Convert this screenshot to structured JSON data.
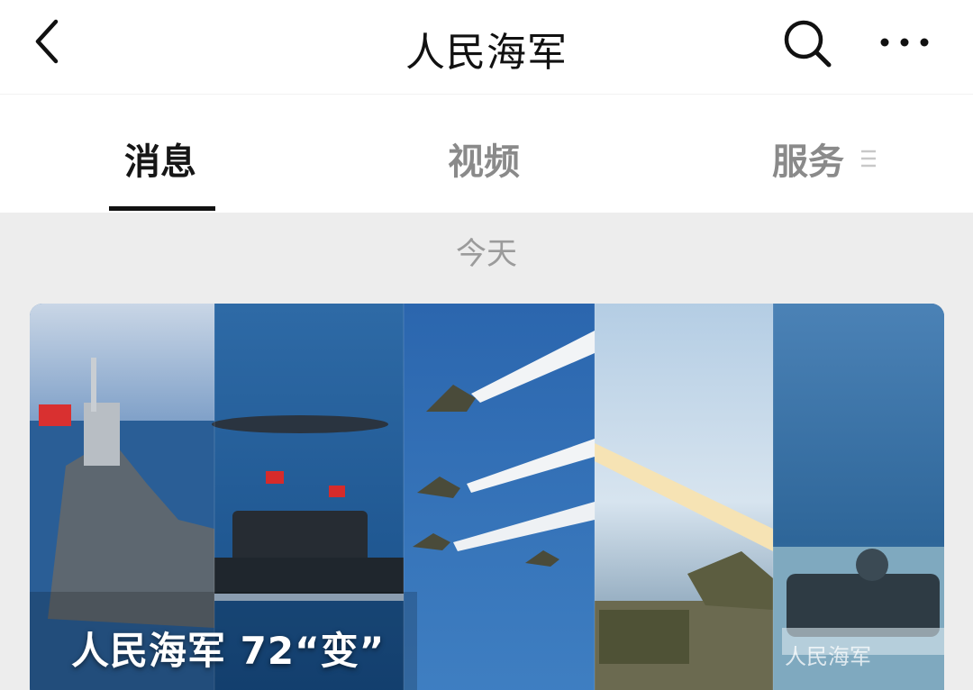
{
  "header": {
    "title": "人民海军",
    "back_icon": "chevron-left-icon",
    "search_icon": "search-icon",
    "more_icon": "more-horizontal-icon"
  },
  "tabs": [
    {
      "label": "消息",
      "active": true
    },
    {
      "label": "视频",
      "active": false
    },
    {
      "label": "服务",
      "active": false
    }
  ],
  "tab_more_icon": "menu-lines-icon",
  "feed": {
    "date_label": "今天",
    "card": {
      "title": "人民海军 72“变”",
      "watermark": "人民海军"
    }
  },
  "colors": {
    "text_primary": "#111111",
    "text_secondary": "#8a8a8a",
    "background": "#ededed",
    "card_sea": "#3d6fa8"
  }
}
